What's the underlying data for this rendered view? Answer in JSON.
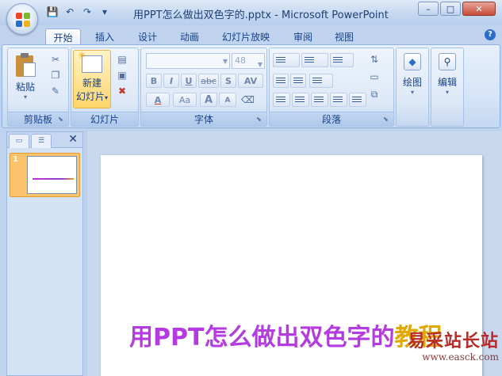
{
  "window": {
    "title": "用PPT怎么做出双色字的.pptx - Microsoft PowerPoint",
    "controls": [
      "–",
      "□",
      "✕"
    ]
  },
  "tabs": [
    "开始",
    "插入",
    "设计",
    "动画",
    "幻灯片放映",
    "审阅",
    "视图"
  ],
  "active_tab": "开始",
  "ribbon": {
    "clipboard": {
      "paste": "粘贴",
      "label": "剪贴板"
    },
    "slides": {
      "new_slide_1": "新建",
      "new_slide_2": "幻灯片",
      "label": "幻灯片"
    },
    "font": {
      "size_value": "48",
      "label": "字体",
      "buttons": [
        "B",
        "I",
        "U",
        "abc",
        "S",
        "AV",
        "A",
        "Aa",
        "A",
        "A"
      ]
    },
    "paragraph": {
      "label": "段落"
    },
    "drawing": {
      "label": "绘图"
    },
    "editing": {
      "label": "编辑"
    }
  },
  "panel": {
    "slide_number": "1"
  },
  "slide": {
    "title_part1": "用PPT怎么做出双色字的",
    "title_part2": "教程",
    "colors": {
      "part1": "#b43be0",
      "part2": "#e0a800"
    }
  },
  "watermark": {
    "cn": "易采站长站",
    "url": "www.easck.com"
  }
}
